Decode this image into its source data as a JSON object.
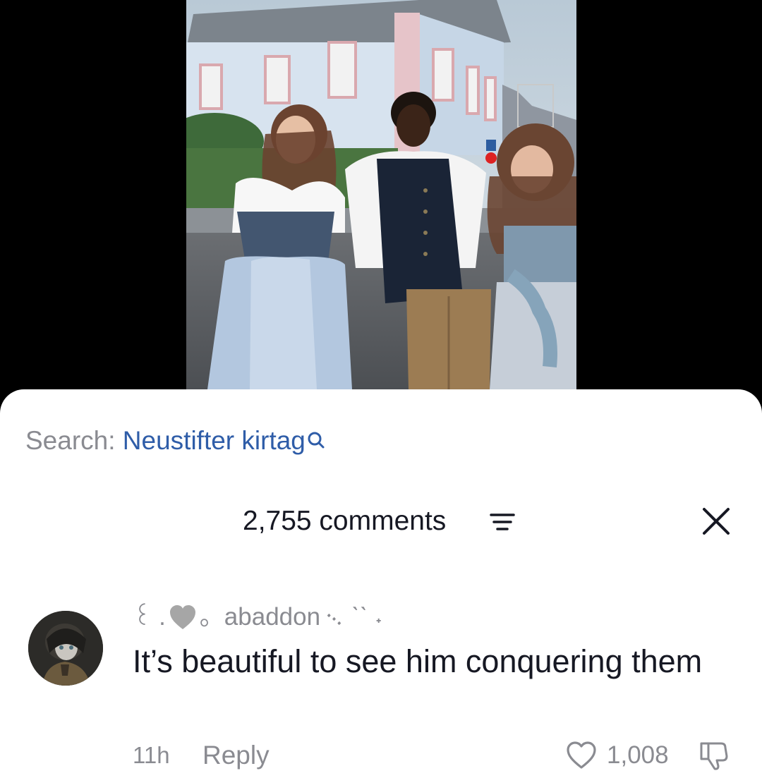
{
  "search": {
    "prefix": "Search:",
    "term": "Neustifter kirtag",
    "icon": "search-icon",
    "term_color": "#2f5da8"
  },
  "comments_header": {
    "count_label": "2,755 comments",
    "sort_icon": "sort-lines-icon",
    "close_icon": "close-icon"
  },
  "comment": {
    "username_pre": "꒰ .",
    "username_emoji": "grey-heart",
    "username_post": "。abaddon ᨞ ˋˋ ˖",
    "text": "It’s beautiful to see him conquering them",
    "timestamp": "11h",
    "reply_label": "Reply",
    "like_count": "1,008",
    "like_icon": "heart-outline-icon",
    "dislike_icon": "thumbs-down-icon"
  },
  "colors": {
    "text_primary": "#161823",
    "text_secondary": "#8a8b91",
    "link": "#2f5da8",
    "background": "#ffffff"
  }
}
